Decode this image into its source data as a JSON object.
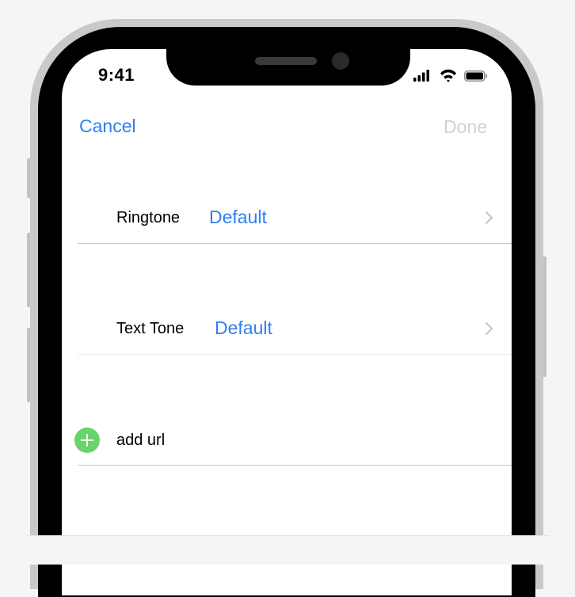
{
  "status_bar": {
    "time": "9:41",
    "icons": [
      "cellular-signal-icon",
      "wifi-icon",
      "battery-icon"
    ]
  },
  "nav": {
    "cancel_label": "Cancel",
    "done_label": "Done"
  },
  "rows": {
    "ringtone": {
      "label": "Ringtone",
      "value": "Default"
    },
    "text_tone": {
      "label": "Text Tone",
      "value": "Default"
    },
    "add_url": {
      "label": "add url"
    }
  },
  "colors": {
    "accent": "#2f7ff0",
    "disabled": "#d1d1d6",
    "add_green": "#69d46a"
  }
}
